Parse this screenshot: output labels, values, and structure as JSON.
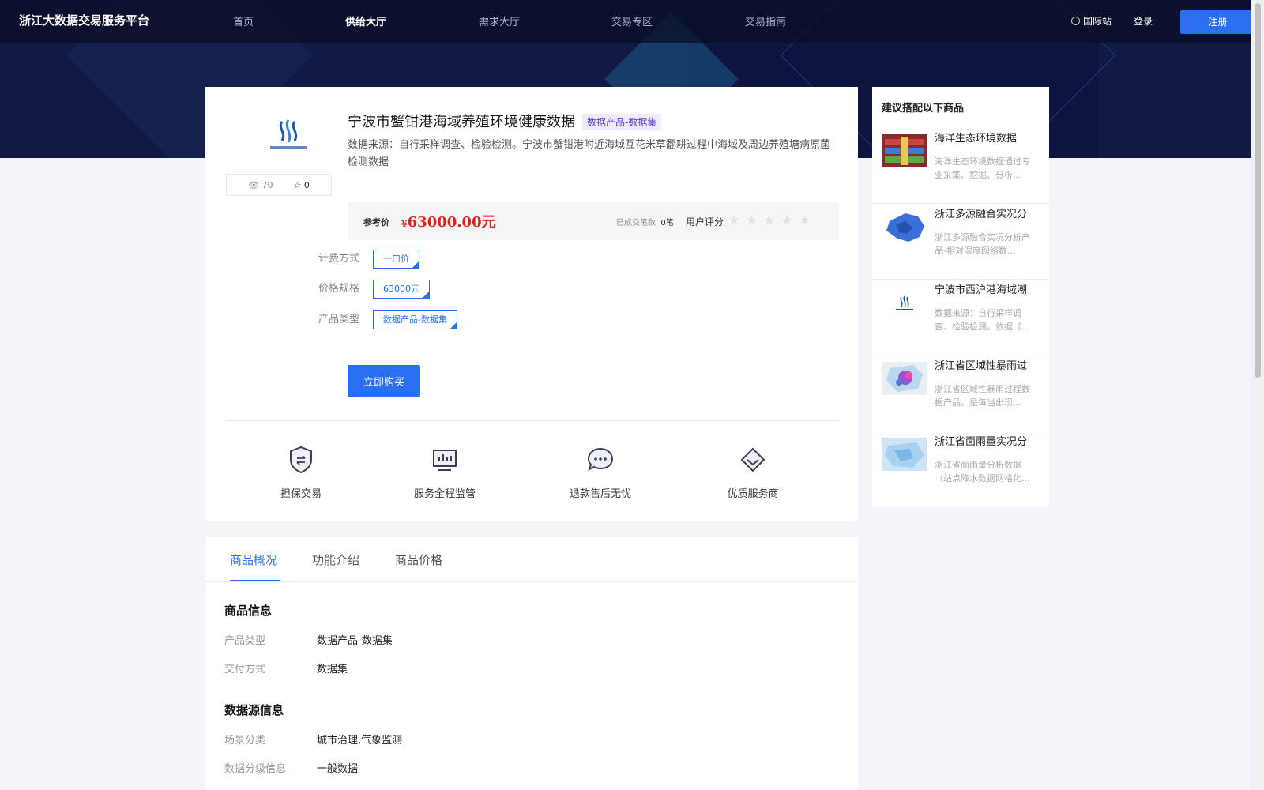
{
  "header": {
    "brand": "浙江大数据交易服务平台",
    "nav": [
      "首页",
      "供给大厅",
      "需求大厅",
      "交易专区",
      "交易指南"
    ],
    "active_nav": "供给大厅",
    "intl": "国际站",
    "login": "登录",
    "register": "注册"
  },
  "product": {
    "stats": {
      "views": "70",
      "favorites": "0"
    },
    "title": "宁波市蟹钳港海域养殖环境健康数据",
    "tag": "数据产品-数据集",
    "description": "数据来源：自行采样调查、检验检测。宁波市蟹钳港附近海域互花米草翻耕过程中海域及周边养殖塘病原菌检测数据",
    "price_label": "参考价",
    "price_currency": "¥",
    "price": "63000.00元",
    "deal_label": "已成交笔数",
    "deal_count": "0笔",
    "rating_label": "用户评分",
    "stars": "★★★★★",
    "specs": [
      {
        "label": "计费方式",
        "value": "一口价"
      },
      {
        "label": "价格规格",
        "value": "63000元"
      },
      {
        "label": "产品类型",
        "value": "数据产品-数据集"
      }
    ],
    "buy_label": "立即购买",
    "features": [
      "担保交易",
      "服务全程监管",
      "退款售后无忧",
      "优质服务商"
    ]
  },
  "sidebar": {
    "title": "建议搭配以下商品",
    "items": [
      {
        "name": "海洋生态环境数据",
        "desc": "海洋生态环境数据通过专业采集、挖掘、分析..."
      },
      {
        "name": "浙江多源融合实况分",
        "desc": "浙江多源融合实况分析产品-相对湿度网络数..."
      },
      {
        "name": "宁波市西沪港海域潮",
        "desc": "数据来源：自行采样调查、检验检测。依据《..."
      },
      {
        "name": "浙江省区域性暴雨过",
        "desc": "浙江省区域性暴雨过程数据产品，是每当出现..."
      },
      {
        "name": "浙江省面雨量实况分",
        "desc": "浙江省面雨量分析数据（站点降水数据网格化..."
      }
    ]
  },
  "tabs": {
    "items": [
      "商品概况",
      "功能介绍",
      "商品价格"
    ],
    "active": "商品概况"
  },
  "details": {
    "product_info_title": "商品信息",
    "product_info": [
      {
        "key": "产品类型",
        "value": "数据产品-数据集"
      },
      {
        "key": "交付方式",
        "value": "数据集"
      }
    ],
    "source_info_title": "数据源信息",
    "source_info": [
      {
        "key": "场景分类",
        "value": "城市治理,气象监测"
      },
      {
        "key": "数据分级信息",
        "value": "一般数据"
      }
    ]
  },
  "colors": {
    "accent": "#2a6ff0",
    "price": "#e2231a",
    "hero_bg": "#111a45",
    "tag_bg": "#efeafc"
  }
}
